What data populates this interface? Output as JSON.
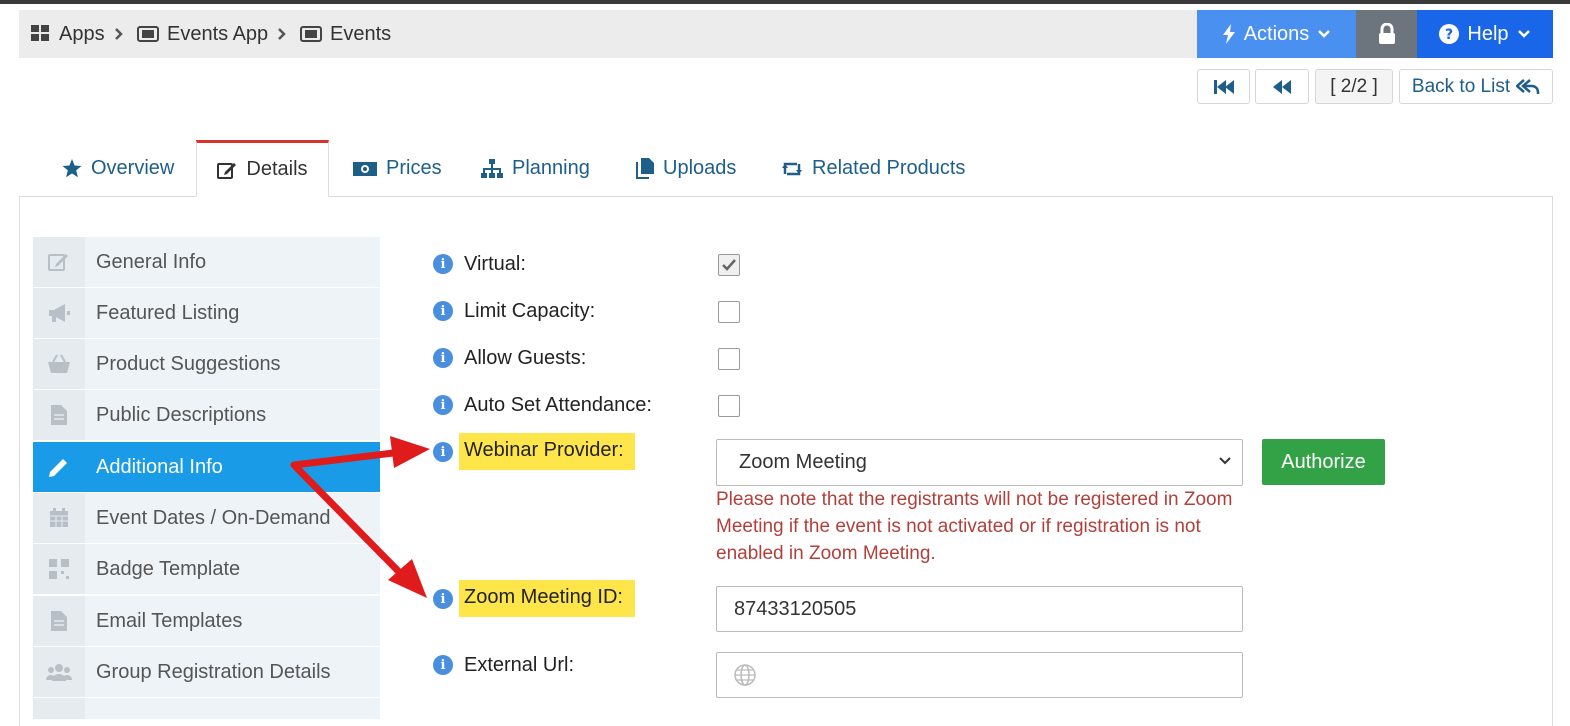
{
  "breadcrumb": {
    "items": [
      {
        "label": "Apps",
        "icon": "grid-icon"
      },
      {
        "label": "Events App",
        "icon": "ticket-icon"
      },
      {
        "label": "Events",
        "icon": "ticket-icon"
      }
    ]
  },
  "toolbar": {
    "actions_label": "Actions",
    "help_label": "Help",
    "lock_icon": "lock-icon"
  },
  "pager": {
    "count": "[ 2/2 ]",
    "back_label": "Back to List"
  },
  "tabs": [
    {
      "label": "Overview",
      "icon": "star-icon"
    },
    {
      "label": "Details",
      "icon": "edit-icon",
      "active": true
    },
    {
      "label": "Prices",
      "icon": "money-icon"
    },
    {
      "label": "Planning",
      "icon": "sitemap-icon"
    },
    {
      "label": "Uploads",
      "icon": "files-icon"
    },
    {
      "label": "Related Products",
      "icon": "retweet-icon"
    }
  ],
  "sidebar": {
    "items": [
      {
        "label": "General Info",
        "icon": "edit-icon"
      },
      {
        "label": "Featured Listing",
        "icon": "megaphone-icon"
      },
      {
        "label": "Product Suggestions",
        "icon": "basket-icon"
      },
      {
        "label": "Public Descriptions",
        "icon": "file-icon"
      },
      {
        "label": "Additional Info",
        "icon": "pencil-icon",
        "active": true
      },
      {
        "label": "Event Dates / On-Demand",
        "icon": "calendar-icon"
      },
      {
        "label": "Badge Template",
        "icon": "qrcode-icon"
      },
      {
        "label": "Email Templates",
        "icon": "file-icon"
      },
      {
        "label": "Group Registration Details",
        "icon": "users-icon"
      }
    ]
  },
  "form": {
    "virtual_label": "Virtual:",
    "virtual_checked": true,
    "limit_capacity_label": "Limit Capacity:",
    "limit_capacity_checked": false,
    "allow_guests_label": "Allow Guests:",
    "allow_guests_checked": false,
    "auto_attendance_label": "Auto Set Attendance:",
    "auto_attendance_checked": false,
    "webinar_provider_label": "Webinar Provider:",
    "webinar_provider_value": "Zoom Meeting",
    "authorize_label": "Authorize",
    "warning_text": "Please note that the registrants will not be registered in Zoom Meeting if the event is not activated or if registration is not enabled in Zoom Meeting.",
    "zoom_id_label": "Zoom Meeting ID:",
    "zoom_id_value": "87433120505",
    "external_url_label": "External Url:",
    "external_url_value": ""
  },
  "colors": {
    "actions": "#4a90f0",
    "help": "#1a66e8",
    "active_nav": "#1a9be8",
    "authorize": "#33a247",
    "highlight": "#fde54a",
    "warning": "#b2403a",
    "annotation_arrow": "#e01b1b"
  }
}
